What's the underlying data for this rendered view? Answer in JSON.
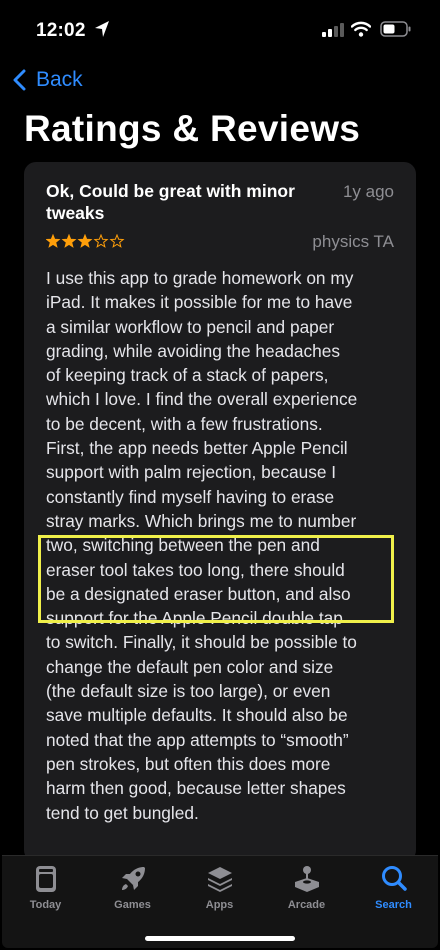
{
  "status_bar": {
    "time": "12:02",
    "icons": [
      "location-arrow-icon",
      "cellular-signal-icon",
      "wifi-icon",
      "battery-icon"
    ]
  },
  "nav": {
    "back_label": "Back",
    "title": "Ratings & Reviews"
  },
  "review": {
    "title": "Ok, Could be great with minor tweaks",
    "date": "1y ago",
    "rating": 3,
    "rating_max": 5,
    "author": "physics TA",
    "body": "I use this app to grade homework on my\niPad. It makes it possible for me to have\na similar workflow to pencil and paper\ngrading, while avoiding the headaches\nof keeping track of a stack of papers,\nwhich I love. I find the overall experience\nto be decent, with a few frustrations.\nFirst, the app needs better Apple Pencil\nsupport with palm rejection, because I\nconstantly find myself having to erase\nstray marks. Which brings me to number\ntwo, switching between the pen and\neraser tool takes too long, there should\nbe a designated eraser button, and also\nsupport for the Apple Pencil double tap\nto switch. Finally, it should be possible to\nchange the default pen color and size\n(the default size is too large), or even\nsave multiple defaults.  It should also be\nnoted that the app attempts to “smooth”\npen strokes, but often this does more\nharm then good, because letter shapes\ntend to get bungled.",
    "highlight_color": "#f0f04a"
  },
  "tabs": [
    {
      "label": "Today",
      "icon": "today-icon",
      "active": false
    },
    {
      "label": "Games",
      "icon": "rocket-icon",
      "active": false
    },
    {
      "label": "Apps",
      "icon": "apps-stack-icon",
      "active": false
    },
    {
      "label": "Arcade",
      "icon": "arcade-joystick-icon",
      "active": false
    },
    {
      "label": "Search",
      "icon": "search-icon",
      "active": true
    }
  ],
  "colors": {
    "accent": "#2f8cff",
    "star": "#ff9f0a",
    "card_bg": "#1c1c1e",
    "secondary_text": "#8e8e93"
  }
}
